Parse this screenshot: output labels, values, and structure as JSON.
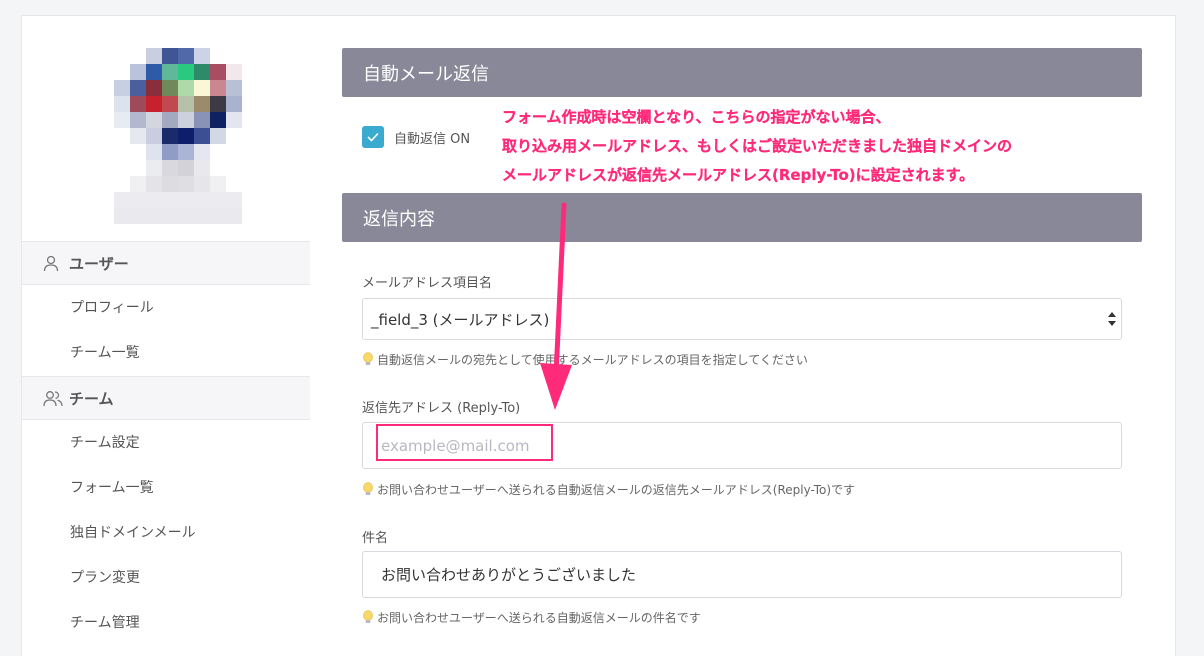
{
  "sidebar": {
    "groups": [
      {
        "label": "ユーザー",
        "icon": "user-icon",
        "items": [
          {
            "label": "プロフィール"
          },
          {
            "label": "チーム一覧"
          }
        ]
      },
      {
        "label": "チーム",
        "icon": "users-icon",
        "items": [
          {
            "label": "チーム設定"
          },
          {
            "label": "フォーム一覧"
          },
          {
            "label": "独自ドメインメール"
          },
          {
            "label": "プラン変更"
          },
          {
            "label": "チーム管理"
          }
        ]
      }
    ]
  },
  "main": {
    "section1": {
      "title": "自動メール返信"
    },
    "auto_reply": {
      "label": "自動返信 ON",
      "checked": true
    },
    "annotation": {
      "lines": [
        "フォーム作成時は空欄となり、こちらの指定がない場合、",
        "取り込み用メールアドレス、もしくはご設定いただきました独自ドメインの",
        "メールアドレスが返信先メールアドレス(Reply-To)に設定されます。"
      ],
      "color": "#ff2a7a"
    },
    "section2": {
      "title": "返信内容"
    },
    "email_field": {
      "label": "メールアドレス項目名",
      "value": "_field_3 (メールアドレス)",
      "hint": "自動返信メールの宛先として使用するメールアドレスの項目を指定してください"
    },
    "reply_to": {
      "label": "返信先アドレス (Reply-To)",
      "placeholder": "example@mail.com",
      "hint": "お問い合わせユーザーへ送られる自動返信メールの返信先メールアドレス(Reply-To)です"
    },
    "subject": {
      "label": "件名",
      "value": "お問い合わせありがとうございました",
      "hint": "お問い合わせユーザーへ送られる自動返信メールの件名です"
    }
  },
  "colors": {
    "accent": "#3aaacf",
    "section_bar": "#888899",
    "annotation": "#ff2a7a"
  }
}
